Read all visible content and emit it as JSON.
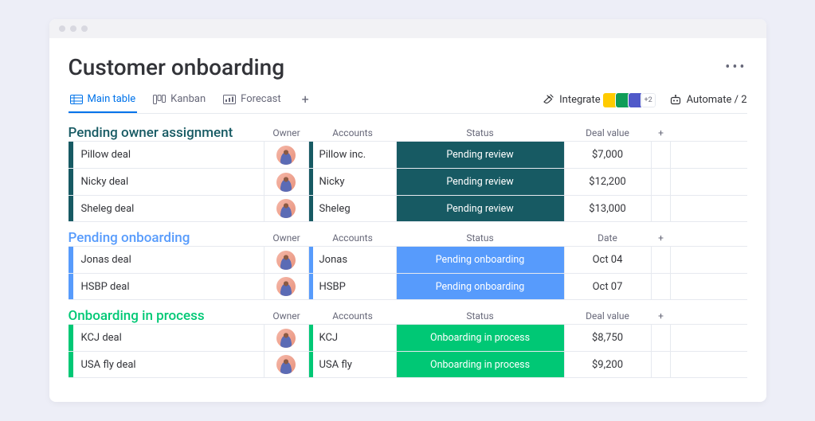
{
  "title": "Customer onboarding",
  "tabs": {
    "main": "Main table",
    "kanban": "Kanban",
    "forecast": "Forecast"
  },
  "actions": {
    "integrate": "Integrate",
    "integrate_extra": "+2",
    "automate": "Automate / 2"
  },
  "cols": {
    "owner": "Owner",
    "accounts": "Accounts",
    "status": "Status",
    "deal_value": "Deal value",
    "date": "Date"
  },
  "groups": [
    {
      "title": "Pending owner assignment",
      "last_col": "Deal value",
      "status_label": "Pending review",
      "rows": [
        {
          "name": "Pillow deal",
          "account": "Pillow inc.",
          "value": "$7,000"
        },
        {
          "name": "Nicky deal",
          "account": "Nicky",
          "value": "$12,200"
        },
        {
          "name": "Sheleg deal",
          "account": "Sheleg",
          "value": "$13,000"
        }
      ]
    },
    {
      "title": "Pending onboarding",
      "last_col": "Date",
      "status_label": "Pending onboarding",
      "rows": [
        {
          "name": "Jonas deal",
          "account": "Jonas",
          "value": "Oct 04"
        },
        {
          "name": "HSBP deal",
          "account": "HSBP",
          "value": "Oct 07"
        }
      ]
    },
    {
      "title": "Onboarding in process",
      "last_col": "Deal value",
      "status_label": "Onboarding in process",
      "rows": [
        {
          "name": "KCJ deal",
          "account": "KCJ",
          "value": "$8,750"
        },
        {
          "name": "USA fly deal",
          "account": "USA fly",
          "value": "$9,200"
        }
      ]
    }
  ]
}
